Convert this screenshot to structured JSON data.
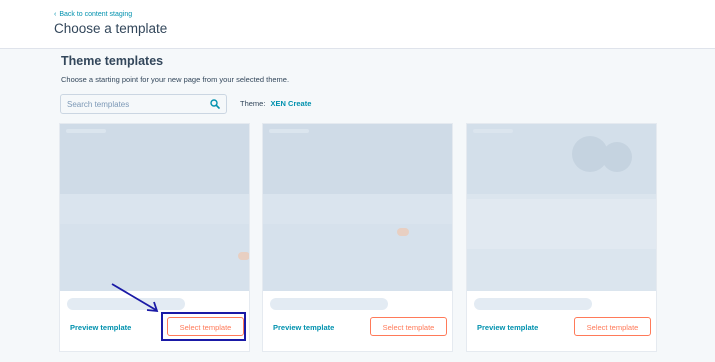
{
  "header": {
    "back_link": "Back to content staging",
    "title": "Choose a template"
  },
  "section": {
    "title": "Theme templates",
    "description": "Choose a starting point for your new page from your selected theme."
  },
  "search": {
    "placeholder": "Search templates",
    "icon": "search-icon"
  },
  "theme": {
    "label": "Theme:",
    "name": "XEN Create"
  },
  "cards": [
    {
      "preview_label": "Preview template",
      "select_label": "Select template"
    },
    {
      "preview_label": "Preview template",
      "select_label": "Select template"
    },
    {
      "preview_label": "Preview template",
      "select_label": "Select template"
    }
  ],
  "colors": {
    "accent": "#0091ae",
    "button": "#ff7a59",
    "annotation": "#1a1aa6"
  }
}
